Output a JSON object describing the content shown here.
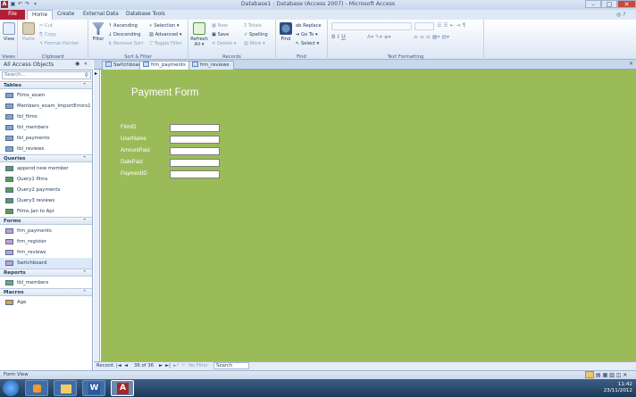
{
  "window": {
    "title": "Database1 : Database (Access 2007) - Microsoft Access",
    "app_icon": "A",
    "min": "–",
    "max": "□",
    "close": "✕"
  },
  "ribbon_tabs": {
    "file": "File",
    "home": "Home",
    "create": "Create",
    "external": "External Data",
    "dbtools": "Database Tools"
  },
  "ribbon": {
    "views": {
      "view": "View",
      "label": "Views"
    },
    "clipboard": {
      "paste": "Paste",
      "cut": "Cut",
      "copy": "Copy",
      "format_painter": "Format Painter",
      "label": "Clipboard"
    },
    "sort": {
      "filter": "Filter",
      "ascending": "Ascending",
      "descending": "Descending",
      "remove_sort": "Remove Sort",
      "selection": "Selection ▾",
      "advanced": "Advanced ▾",
      "toggle_filter": "Toggle Filter",
      "label": "Sort & Filter"
    },
    "records": {
      "refresh": "Refresh All ▾",
      "new": "New",
      "save": "Save",
      "delete": "Delete ▾",
      "totals": "Totals",
      "spelling": "Spelling",
      "more": "More ▾",
      "label": "Records"
    },
    "find": {
      "find": "Find",
      "replace": "Replace",
      "goto": "Go To ▾",
      "select": "Select ▾",
      "label": "Find"
    },
    "text_formatting": {
      "label": "Text Formatting"
    }
  },
  "nav": {
    "header": "All Access Objects",
    "search_placeholder": "Search...",
    "sections": [
      {
        "title": "Tables",
        "items": [
          "Films_exam",
          "Members_exam_ImportErrors1",
          "tbl_films",
          "tbl_members",
          "tbl_payments",
          "tbl_reviews"
        ]
      },
      {
        "title": "Queries",
        "items": [
          "append new member",
          "Query1 films",
          "Query2 payments",
          "Query3 reviews",
          "Films Jan to Apr"
        ]
      },
      {
        "title": "Forms",
        "items": [
          "frm_payments",
          "frm_register",
          "frm_reviews",
          "Switchboard"
        ]
      },
      {
        "title": "Reports",
        "items": [
          "tbl_members"
        ]
      },
      {
        "title": "Macros",
        "items": [
          "Age"
        ]
      }
    ]
  },
  "doc_tabs": [
    "Switchboard",
    "frm_payments",
    "frm_reviews"
  ],
  "form": {
    "title": "Payment Form",
    "fields": [
      "FilmID",
      "UserName",
      "AmountPaid",
      "DatePaid",
      "PaymentID"
    ],
    "background": "#9bbb59"
  },
  "record_nav": {
    "label": "Record:",
    "first": "|◄",
    "prev": "◄",
    "position": "36 of 36",
    "next": "►",
    "last": "►|",
    "new": "►*",
    "filter": "No Filter",
    "search": "Search"
  },
  "status": {
    "left": "Form View"
  },
  "taskbar": {
    "time": "11:42",
    "date": "23/11/2012"
  }
}
